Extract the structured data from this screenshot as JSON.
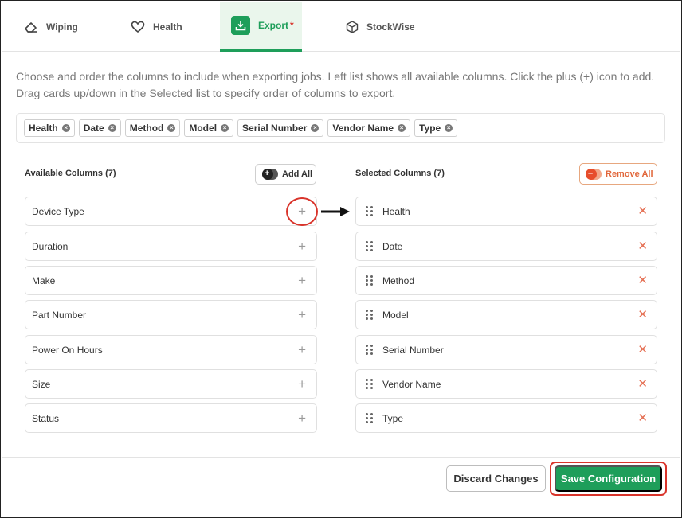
{
  "tabs": [
    {
      "label": "Wiping",
      "icon": "eraser-icon"
    },
    {
      "label": "Health",
      "icon": "heart-icon"
    },
    {
      "label": "Export",
      "icon": "download-icon",
      "active": true,
      "unsaved_marker": "*"
    },
    {
      "label": "StockWise",
      "icon": "box-icon"
    }
  ],
  "description": "Choose and order the columns to include when exporting jobs. Left list shows all available columns. Click the plus (+) icon to add. Drag cards up/down in the Selected list to specify order of columns to export.",
  "chips": [
    "Health",
    "Date",
    "Method",
    "Model",
    "Serial Number",
    "Vendor Name",
    "Type"
  ],
  "available": {
    "title": "Available Columns (7)",
    "add_all_label": "Add All",
    "items": [
      "Device Type",
      "Duration",
      "Make",
      "Part Number",
      "Power On Hours",
      "Size",
      "Status"
    ]
  },
  "selected": {
    "title": "Selected Columns (7)",
    "remove_all_label": "Remove All",
    "items": [
      "Health",
      "Date",
      "Method",
      "Model",
      "Serial Number",
      "Vendor Name",
      "Type"
    ]
  },
  "footer": {
    "discard_label": "Discard Changes",
    "save_label": "Save Configuration"
  },
  "colors": {
    "accent": "#1e9e5a",
    "danger": "#e56f53",
    "annotation": "#d9342b"
  }
}
